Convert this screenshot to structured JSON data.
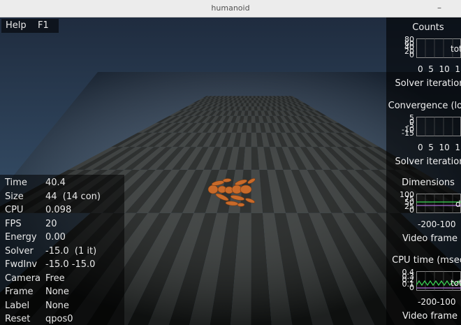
{
  "window": {
    "title": "humanoid",
    "minimize_glyph": "–"
  },
  "help": {
    "key": "Help",
    "value": "F1"
  },
  "info": [
    {
      "key": "Time",
      "value": "40.4"
    },
    {
      "key": "Size",
      "value": "44  (14 con)"
    },
    {
      "key": "CPU",
      "value": "0.098"
    },
    {
      "key": "FPS",
      "value": "20"
    },
    {
      "key": "Energy",
      "value": "0.00"
    },
    {
      "key": "Solver",
      "value": "-15.0  (1 it)"
    },
    {
      "key": "FwdInv",
      "value": "-15.0 -15.0"
    },
    {
      "key": "Camera",
      "value": "Free"
    },
    {
      "key": "Frame",
      "value": "None"
    },
    {
      "key": "Label",
      "value": "None"
    },
    {
      "key": "Reset",
      "value": "qpos0"
    }
  ],
  "figures": [
    {
      "title": "Counts",
      "xlabel": "Solver iteration",
      "xticks": "0  5  10  1",
      "yticks": [
        "80",
        "60",
        "40",
        "20",
        "0"
      ],
      "legend": "tot"
    },
    {
      "title": "Convergence (log",
      "xlabel": "Solver iteration",
      "xticks": "0  5  10  1",
      "yticks": [
        "5",
        "0",
        "-5",
        "-10",
        "-15"
      ],
      "legend": ""
    },
    {
      "title": "Dimensions",
      "xlabel": "Video frame",
      "xticks": "-200-100",
      "yticks": [
        "100",
        "75",
        "50",
        "25",
        "0"
      ],
      "legend": "d"
    },
    {
      "title": "CPU time (msec",
      "xlabel": "Video frame",
      "xticks": "-200-100",
      "yticks": [
        "0.4",
        "0.3",
        "0.2",
        "0.1",
        "0"
      ],
      "legend": "tot"
    }
  ],
  "colors": {
    "sky_top": "#1f2c3f",
    "sky_horizon": "#41607d",
    "tile_light": "#2e3231",
    "tile_dark": "#151817",
    "body": "#c86a2a",
    "plot_line_green": "#39d353",
    "plot_line_purple": "#a86bd1"
  },
  "icons": [
    "minimize-icon",
    "humanoid-body"
  ]
}
